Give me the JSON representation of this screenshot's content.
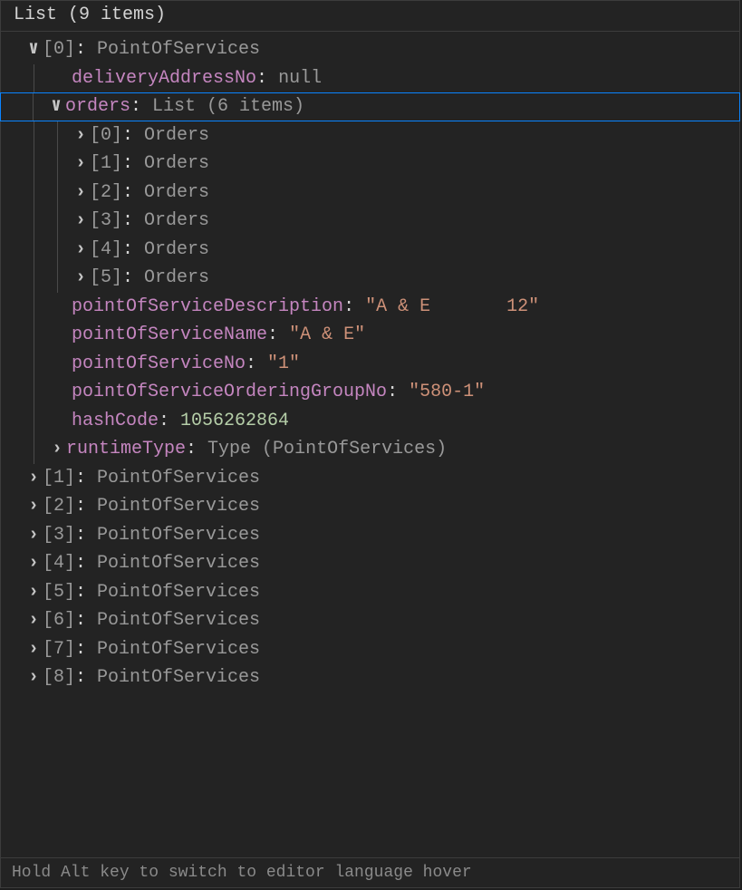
{
  "header": "List (9 items)",
  "footer": "Hold Alt key to switch to editor language hover",
  "chevrons": {
    "expanded": "∨",
    "collapsed": "›"
  },
  "root": {
    "index0": {
      "idx": "[0]",
      "type": "PointOfServices"
    },
    "deliveryAddressNo": {
      "key": "deliveryAddressNo",
      "value": "null"
    },
    "orders": {
      "key": "orders",
      "summary": "List (6 items)",
      "items": [
        {
          "idx": "[0]",
          "type": "Orders"
        },
        {
          "idx": "[1]",
          "type": "Orders"
        },
        {
          "idx": "[2]",
          "type": "Orders"
        },
        {
          "idx": "[3]",
          "type": "Orders"
        },
        {
          "idx": "[4]",
          "type": "Orders"
        },
        {
          "idx": "[5]",
          "type": "Orders"
        }
      ]
    },
    "props": {
      "pointOfServiceDescription": {
        "key": "pointOfServiceDescription",
        "value": "\"A & E       12\""
      },
      "pointOfServiceName": {
        "key": "pointOfServiceName",
        "value": "\"A & E\""
      },
      "pointOfServiceNo": {
        "key": "pointOfServiceNo",
        "value": "\"1\""
      },
      "pointOfServiceOrderingGroupNo": {
        "key": "pointOfServiceOrderingGroupNo",
        "value": "\"580-1\""
      },
      "hashCode": {
        "key": "hashCode",
        "value": "1056262864"
      }
    },
    "runtimeType": {
      "key": "runtimeType",
      "value": "Type (PointOfServices)"
    },
    "siblings": [
      {
        "idx": "[1]",
        "type": "PointOfServices"
      },
      {
        "idx": "[2]",
        "type": "PointOfServices"
      },
      {
        "idx": "[3]",
        "type": "PointOfServices"
      },
      {
        "idx": "[4]",
        "type": "PointOfServices"
      },
      {
        "idx": "[5]",
        "type": "PointOfServices"
      },
      {
        "idx": "[6]",
        "type": "PointOfServices"
      },
      {
        "idx": "[7]",
        "type": "PointOfServices"
      },
      {
        "idx": "[8]",
        "type": "PointOfServices"
      }
    ]
  }
}
